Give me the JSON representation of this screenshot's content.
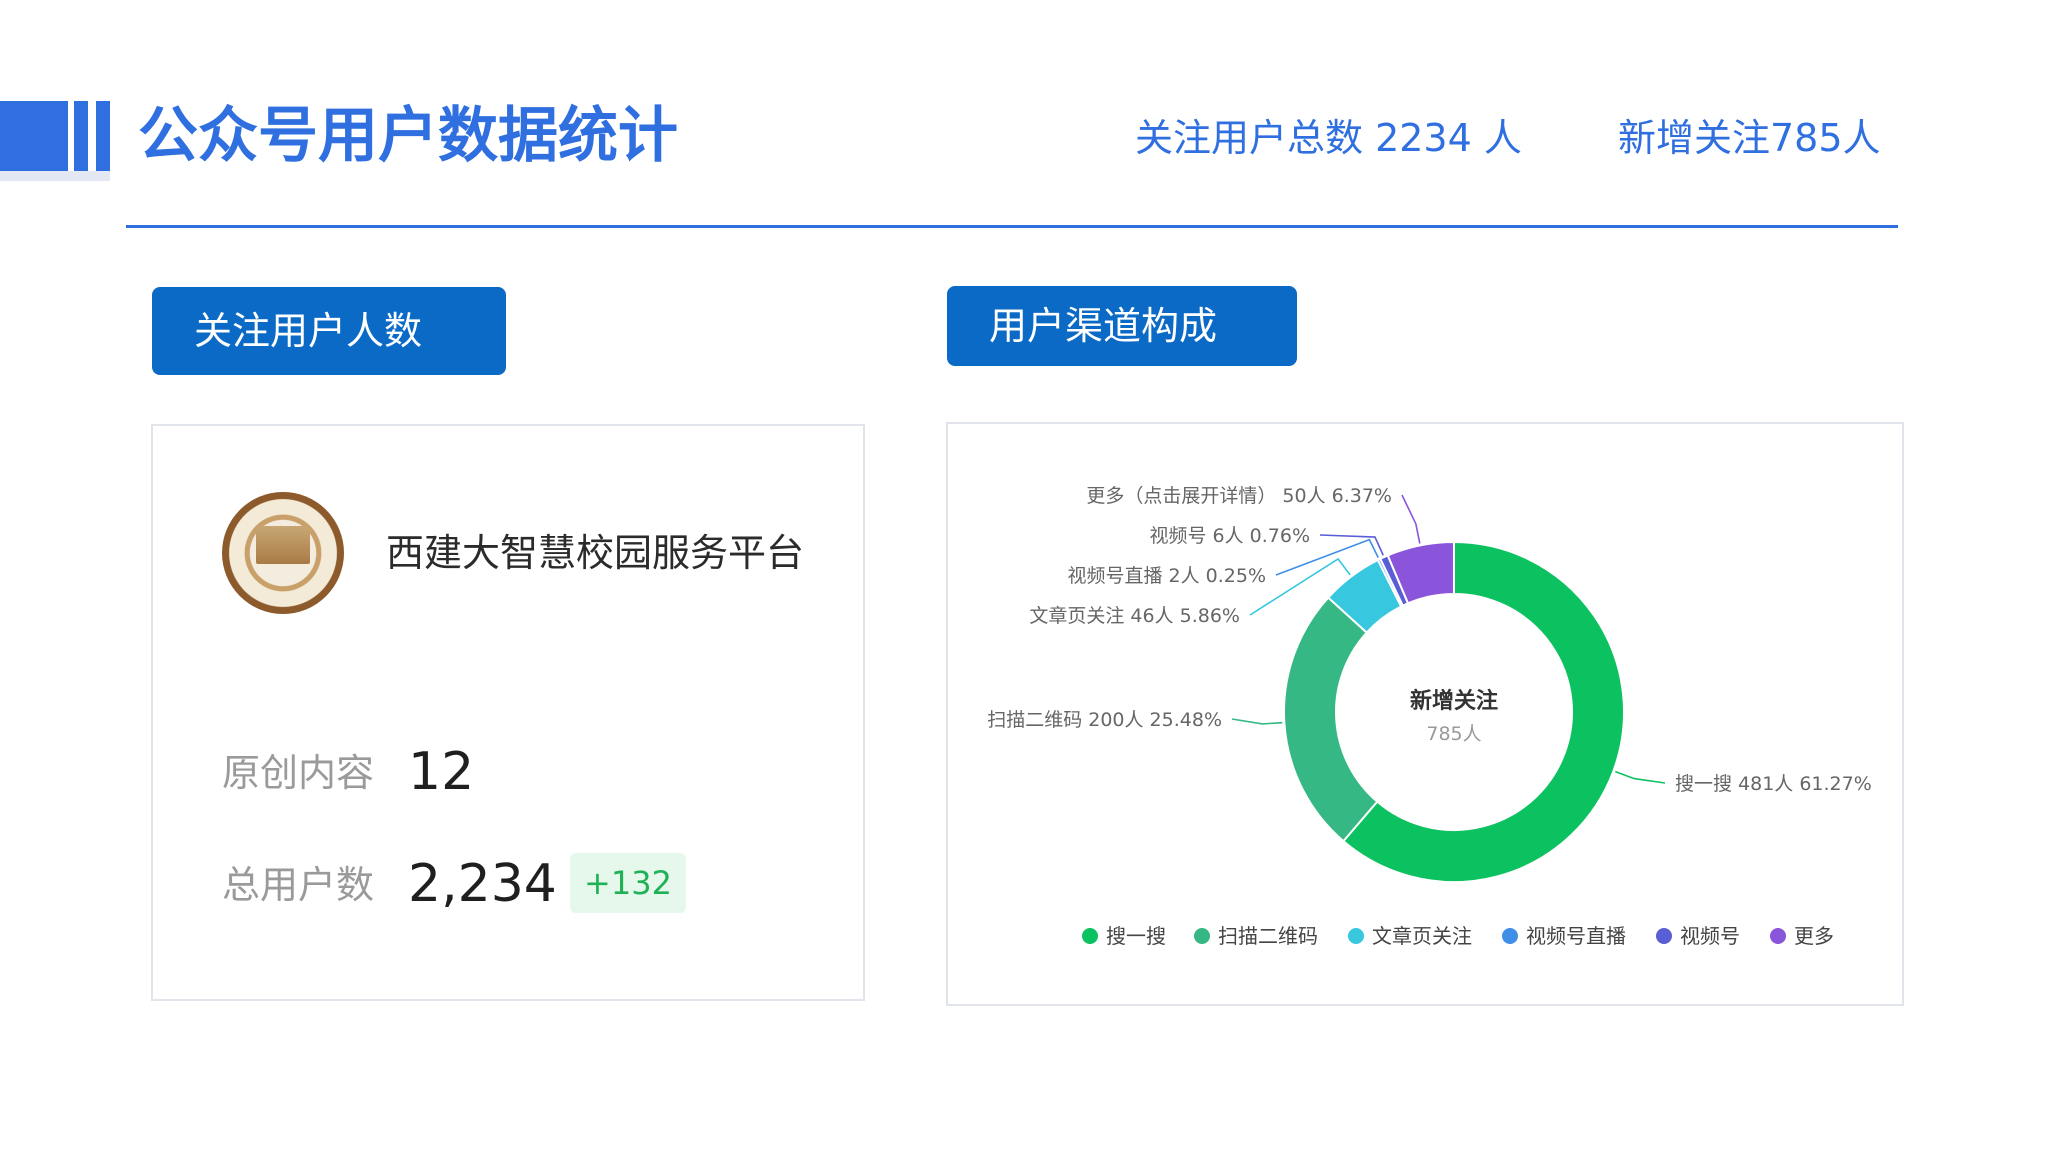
{
  "header": {
    "title": "公众号用户数据统计",
    "total_followers_text": "关注用户总数  2234 人",
    "new_followers_text": "新增关注785人"
  },
  "left_section": {
    "tag": "关注用户人数",
    "account_name": "西建大智慧校园服务平台",
    "original_label": "原创内容",
    "original_value": "12",
    "users_label": "总用户数",
    "users_value": "2,234",
    "users_delta": "+132"
  },
  "right_section": {
    "tag": "用户渠道构成"
  },
  "chart_data": {
    "type": "pie",
    "center_title": "新增关注",
    "center_value": "785人",
    "slices": [
      {
        "name": "搜一搜",
        "value": 481,
        "label": "搜一搜 481人 61.27%",
        "color": "#0cc160"
      },
      {
        "name": "扫描二维码",
        "value": 200,
        "label": "扫描二维码 200人 25.48%",
        "color": "#35b884"
      },
      {
        "name": "文章页关注",
        "value": 46,
        "label": "文章页关注 46人 5.86%",
        "color": "#37c8e0"
      },
      {
        "name": "视频号直播",
        "value": 2,
        "label": "视频号直播 2人 0.25%",
        "color": "#3f8fe8"
      },
      {
        "name": "视频号",
        "value": 6,
        "label": "视频号 6人 0.76%",
        "color": "#5a5ed6"
      },
      {
        "name": "更多",
        "value": 50,
        "label": "更多（点击展开详情） 50人 6.37%",
        "color": "#8a55db"
      }
    ],
    "legend": [
      "搜一搜",
      "扫描二维码",
      "文章页关注",
      "视频号直播",
      "视频号",
      "更多"
    ],
    "legend_position": "bottom"
  }
}
